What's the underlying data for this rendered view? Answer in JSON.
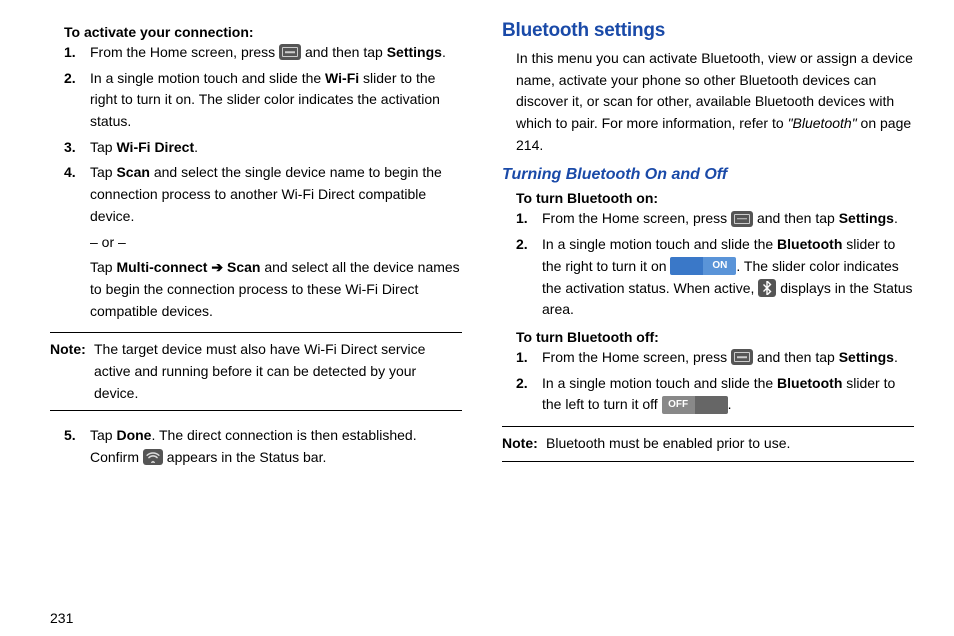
{
  "left": {
    "title": "To activate your connection:",
    "items": {
      "i1a": "From the Home screen, press ",
      "i1b": " and then tap ",
      "settings": "Settings",
      "i1c": ".",
      "i2a": "In a single motion touch and slide the ",
      "wifi": "Wi-Fi",
      "i2b": " slider to the right to turn it on. The slider color indicates the activation status.",
      "i3a": "Tap ",
      "wifidirect": "Wi-Fi Direct",
      "i3b": ".",
      "i4a": "Tap ",
      "scan": "Scan",
      "i4b": " and select the single device name to begin the connection process to another Wi-Fi Direct compatible device.",
      "or": "– or –",
      "i4c": "Tap ",
      "multi": "Multi-connect ",
      "arrow": "➔",
      "scan2": " Scan",
      "i4d": " and select all the device names to begin the connection process to these Wi-Fi Direct compatible devices.",
      "noteKey": "Note:",
      "noteText": "The target device must also have Wi-Fi Direct service active and running before it can be detected by your device.",
      "i5a": "Tap ",
      "done": "Done",
      "i5b": ". The direct connection is then established. Confirm ",
      "i5c": " appears in the Status bar."
    },
    "page": "231"
  },
  "right": {
    "h1": "Bluetooth settings",
    "intro1": "In this menu you can activate Bluetooth, view or assign a device name, activate your phone so other Bluetooth devices can discover it, or scan for other, available Bluetooth devices with which to pair. For more information, refer to ",
    "introItalic": "\"Bluetooth\"",
    "intro2": " on page 214.",
    "h2": "Turning Bluetooth On and Off",
    "onTitle": "To turn Bluetooth on:",
    "on": {
      "i1a": "From the Home screen, press ",
      "i1b": " and then tap ",
      "settings": "Settings",
      "i1c": ".",
      "i2a": "In a single motion touch and slide the ",
      "bt": "Bluetooth",
      "i2b": " slider to the right to turn it on ",
      "onLabel": "ON",
      "i2c": ". The slider color indicates the activation status. When active, ",
      "i2d": " displays in the Status area."
    },
    "offTitle": "To turn Bluetooth off:",
    "off": {
      "i1a": "From the Home screen, press ",
      "i1b": " and then tap ",
      "settings": "Settings",
      "i1c": ".",
      "i2a": "In a single motion touch and slide the ",
      "bt": "Bluetooth",
      "i2b": " slider to the left to turn it off ",
      "offLabel": "OFF",
      "i2c": "."
    },
    "noteKey": "Note:",
    "noteText": "Bluetooth must be enabled prior to use."
  }
}
